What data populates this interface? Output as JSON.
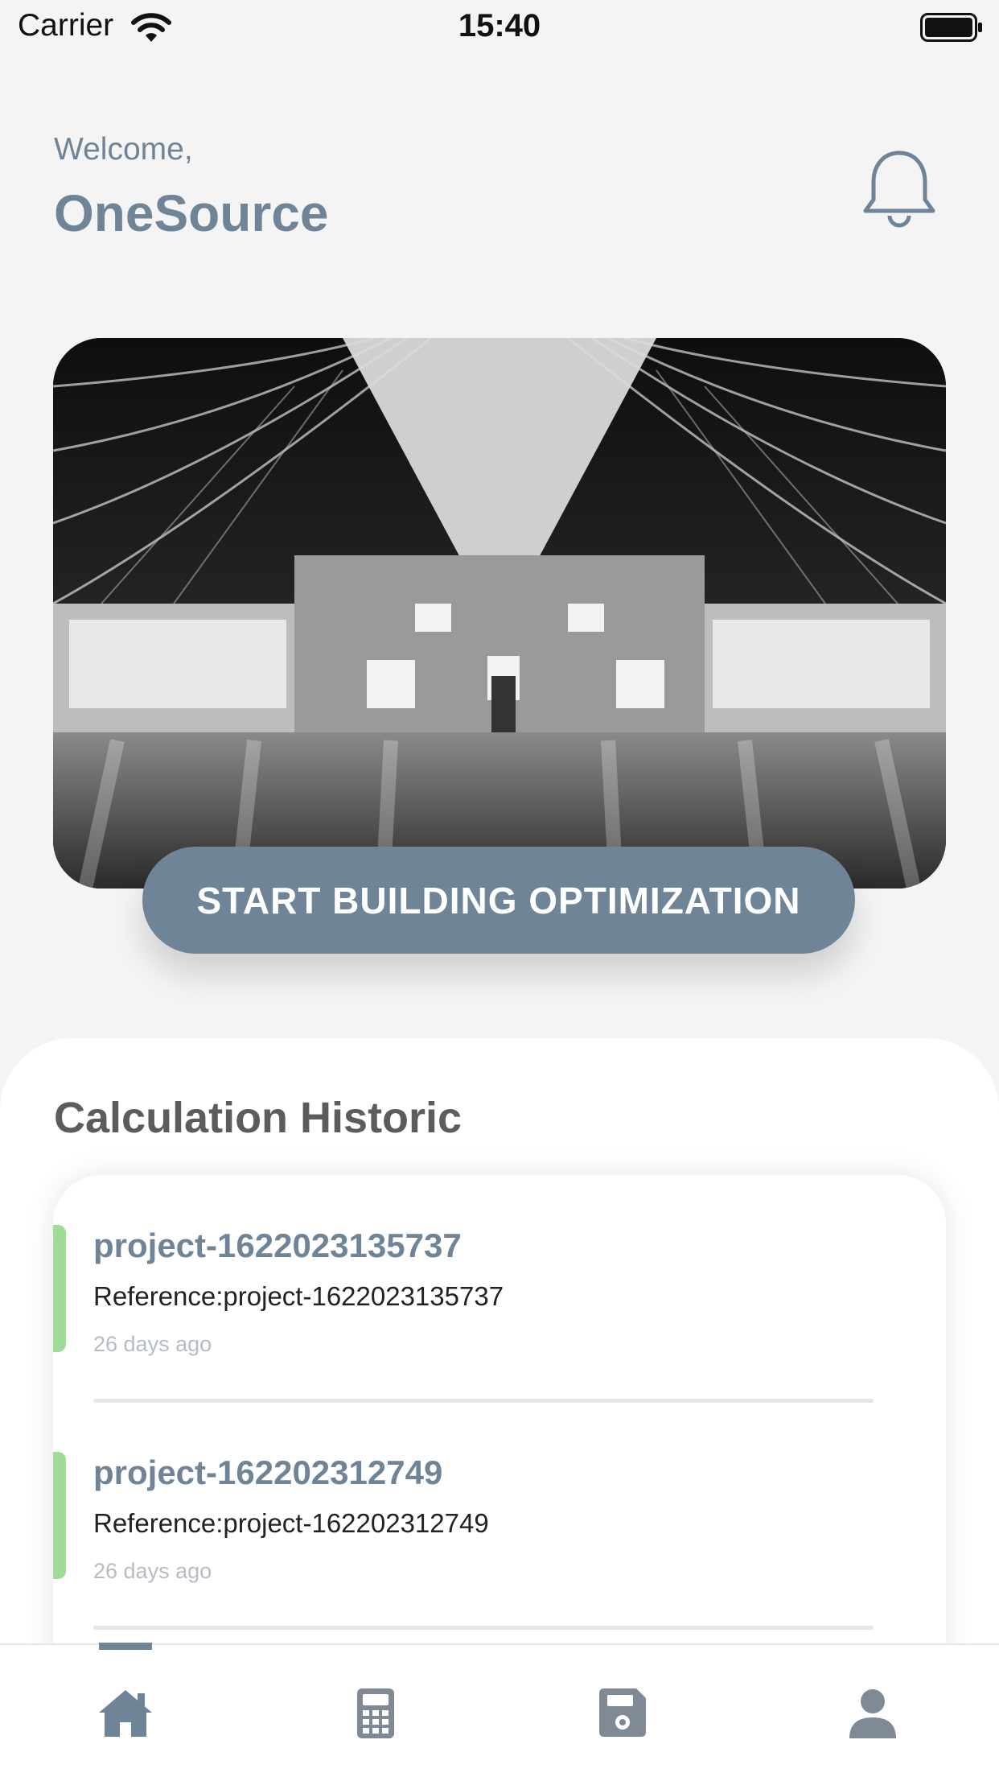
{
  "status_bar": {
    "carrier": "Carrier",
    "time": "15:40",
    "icons": [
      "wifi-icon",
      "battery-icon"
    ]
  },
  "header": {
    "welcome": "Welcome,",
    "username": "OneSource",
    "notification_icon": "bell-icon"
  },
  "hero": {
    "cta_label": "START BUILDING OPTIMIZATION"
  },
  "history": {
    "title": "Calculation Historic",
    "items": [
      {
        "title": "project-1622023135737",
        "reference": "Reference:project-1622023135737",
        "time": "26 days ago"
      },
      {
        "title": "project-162202312749",
        "reference": "Reference:project-162202312749",
        "time": "26 days ago"
      }
    ]
  },
  "tab_bar": {
    "tabs": [
      "home-icon",
      "calculator-icon",
      "save-icon",
      "user-icon"
    ],
    "active_tab": "home-icon"
  },
  "colors": {
    "accent": "#6f8496",
    "status_green": "#9fdc95",
    "background": "#f4f4f4"
  }
}
